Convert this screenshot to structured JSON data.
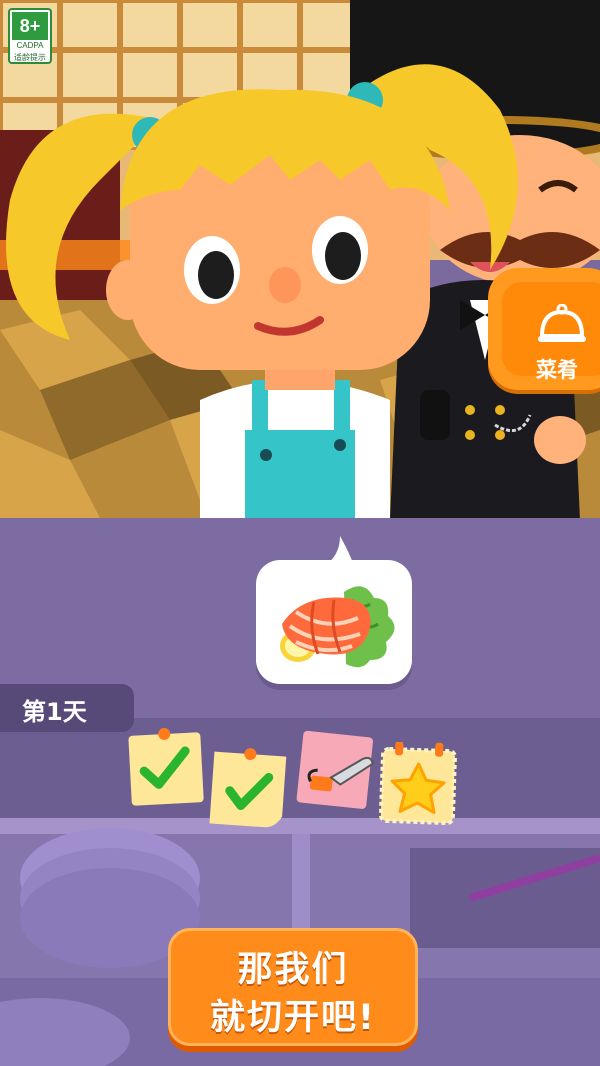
{
  "age_rating": {
    "value": "8+",
    "org": "CADPA",
    "tip": "适龄提示"
  },
  "menu_button": {
    "label": "菜肴"
  },
  "order_bubble": {
    "dish_icon": "salmon-sashimi-icon"
  },
  "day": {
    "label": "第1天"
  },
  "progress": {
    "steps": [
      {
        "icon": "checkmark-icon",
        "status": "done"
      },
      {
        "icon": "checkmark-icon",
        "status": "done"
      },
      {
        "icon": "chainsaw-icon",
        "status": "current"
      },
      {
        "icon": "star-icon",
        "status": "bonus"
      }
    ]
  },
  "cta": {
    "line1": "那我们",
    "line2": "就切开吧!"
  },
  "colors": {
    "accent_orange": "#ff8c1a",
    "check_green": "#2bb52e",
    "counter_purple": "#7a6a9e"
  }
}
